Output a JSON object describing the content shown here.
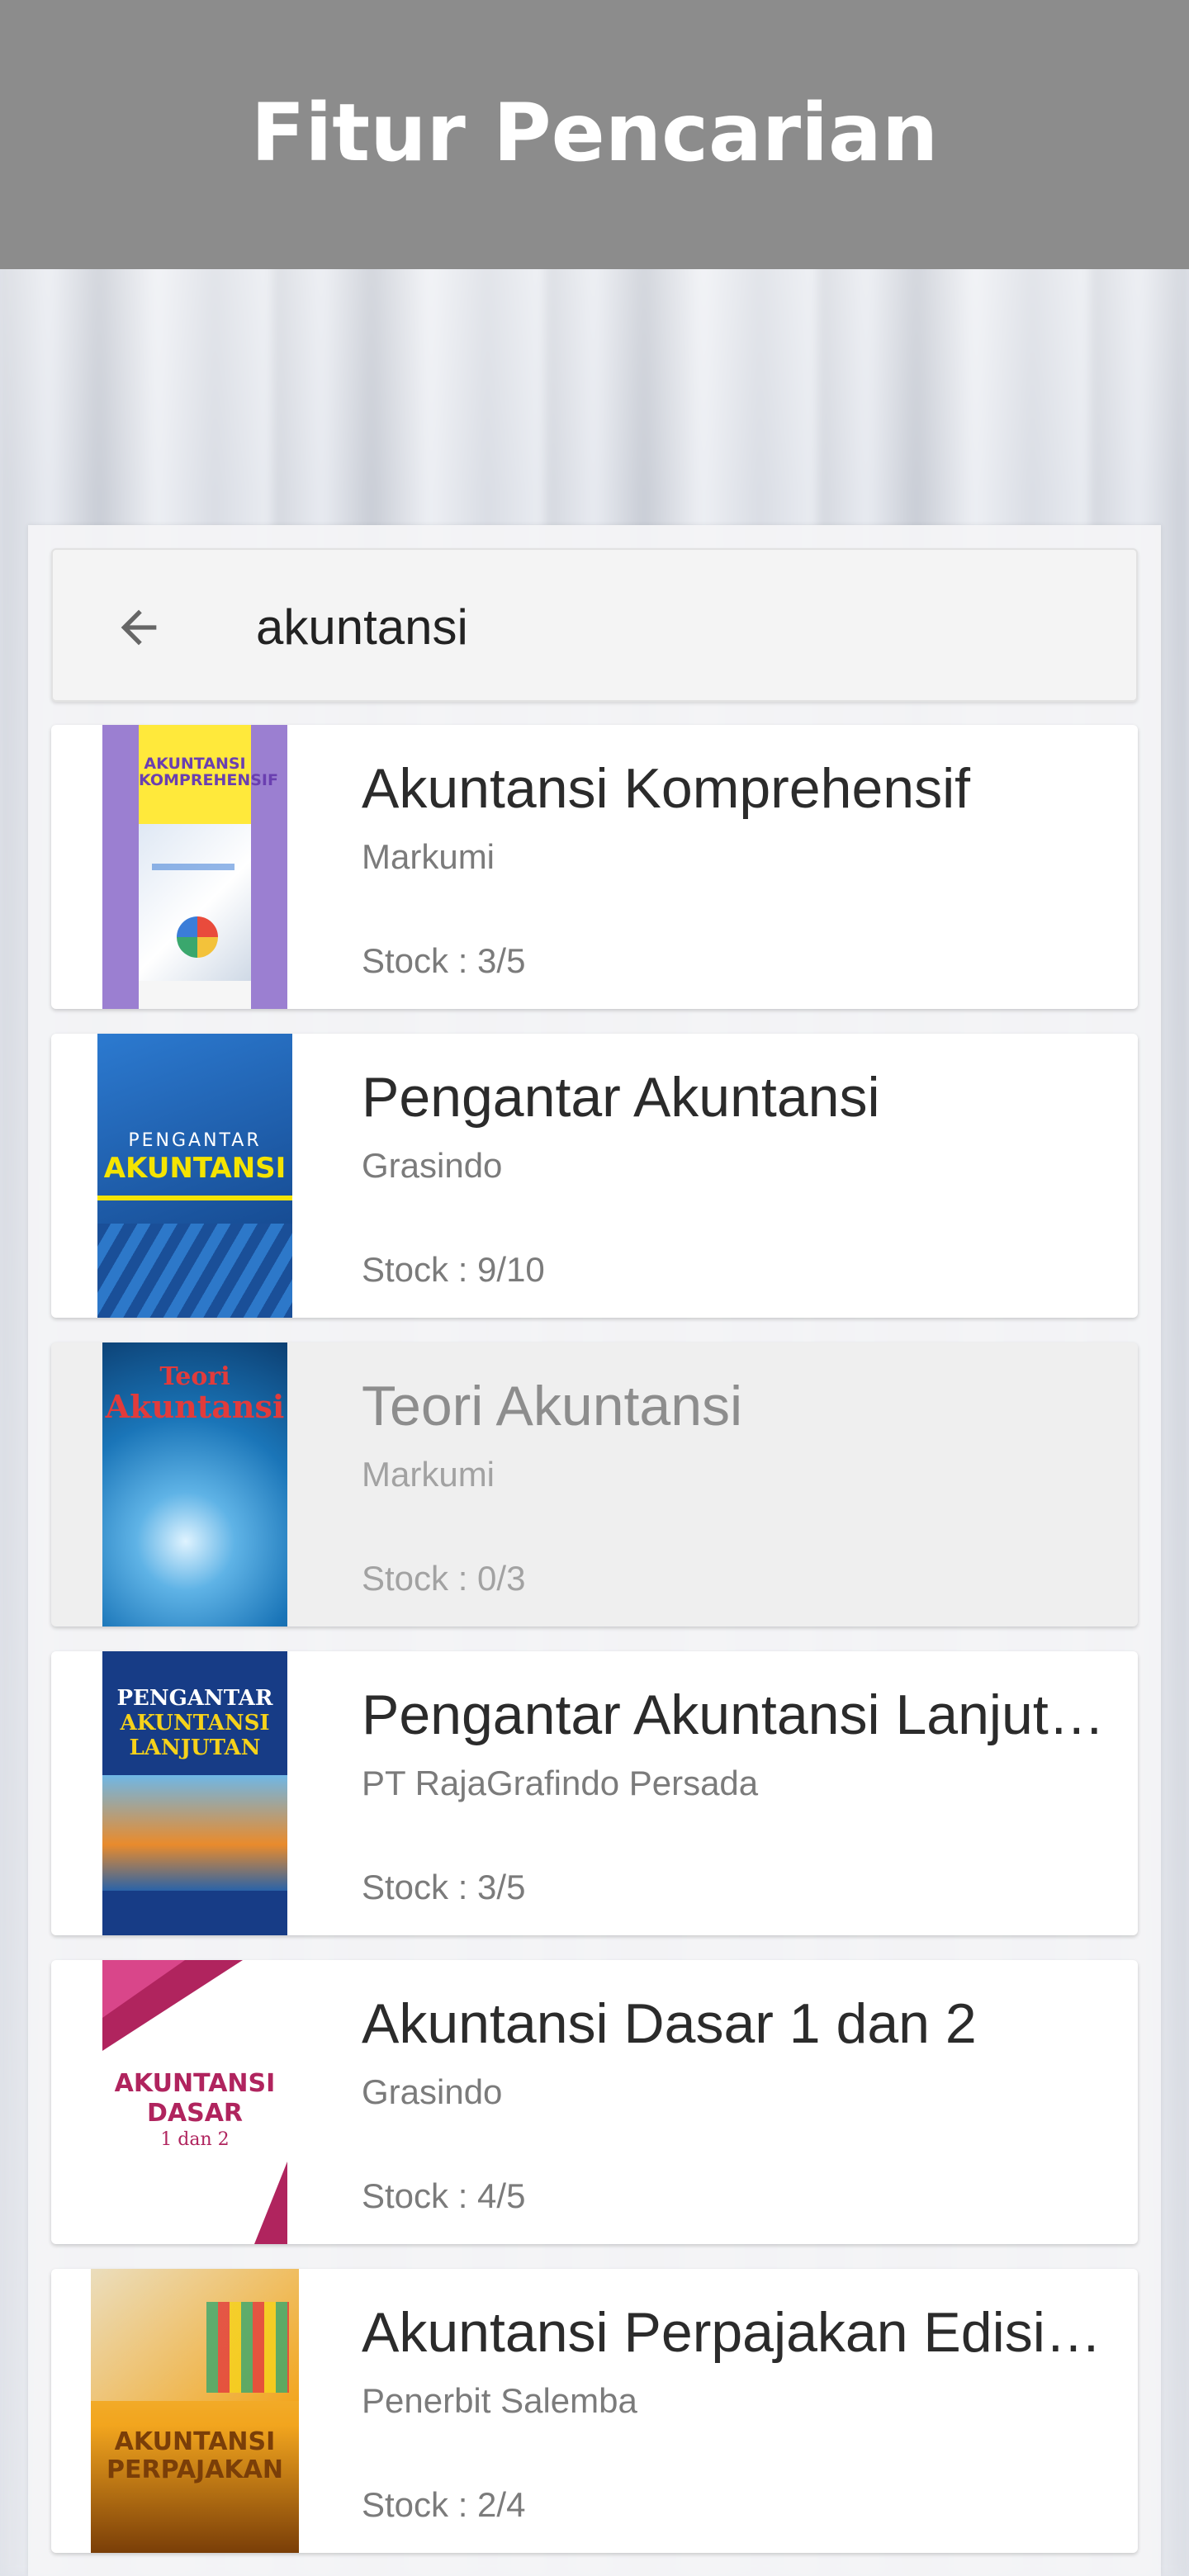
{
  "header": {
    "title": "Fitur Pencarian"
  },
  "search": {
    "query": "akuntansi",
    "placeholder": ""
  },
  "results": [
    {
      "title": "Akuntansi Komprehensif",
      "publisher": "Markumi",
      "stock": "Stock : 3/5",
      "available": true,
      "cover": {
        "text": "AKUNTANSI KOMPREHENSIF",
        "colors": {
          "band": "#9b7fd1",
          "panel": "#ffe93b",
          "text": "#6a3fb0"
        }
      }
    },
    {
      "title": "Pengantar Akuntansi",
      "publisher": "Grasindo",
      "stock": "Stock : 9/10",
      "available": true,
      "cover": {
        "text1": "PENGANTAR",
        "text2": "AKUNTANSI",
        "colors": {
          "bg": "#1d5fae",
          "accent": "#f5e400"
        }
      }
    },
    {
      "title": "Teori Akuntansi",
      "publisher": "Markumi",
      "stock": "Stock : 0/3",
      "available": false,
      "cover": {
        "text1": "Teori",
        "text2": "Akuntansi",
        "colors": {
          "bg": "#1a75b8",
          "accent": "#e23b3b"
        }
      }
    },
    {
      "title": "Pengantar Akuntansi Lanjut…",
      "publisher": "PT RajaGrafindo Persada",
      "stock": "Stock : 3/5",
      "available": true,
      "cover": {
        "text1": "PENGANTAR",
        "text2": "AKUNTANSI",
        "text3": "LANJUTAN",
        "colors": {
          "bg": "#173c86",
          "accent": "#f6d21a"
        }
      }
    },
    {
      "title": "Akuntansi Dasar 1 dan 2",
      "publisher": "Grasindo",
      "stock": "Stock : 4/5",
      "available": true,
      "cover": {
        "text1": "AKUNTANSI",
        "text2": "DASAR",
        "text3": "1 dan 2",
        "colors": {
          "bg": "#ffffff",
          "accent": "#b0245e"
        }
      }
    },
    {
      "title": "Akuntansi Perpajakan Edisi…",
      "publisher": "Penerbit Salemba",
      "stock": "Stock : 2/4",
      "available": true,
      "cover": {
        "text1": "AKUNTANSI",
        "text2": "PERPAJAKAN",
        "colors": {
          "bg": "#f2a51e",
          "accent": "#7a3e08"
        }
      }
    }
  ]
}
